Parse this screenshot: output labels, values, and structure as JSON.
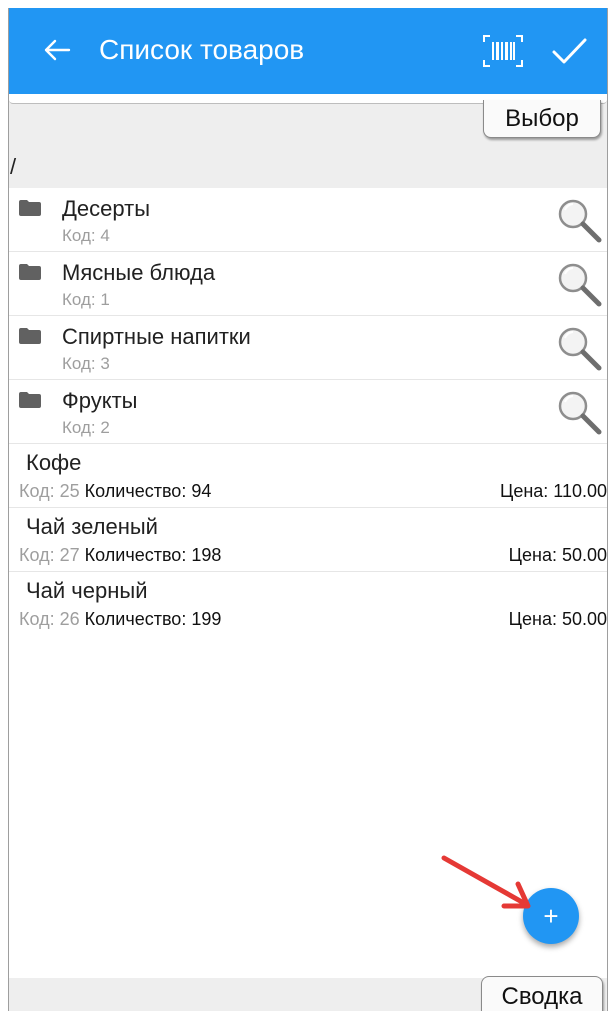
{
  "app_bar": {
    "title": "Список товаров",
    "back_icon": "arrow-left-icon",
    "barcode_icon": "barcode-scan-icon",
    "confirm_icon": "check-icon",
    "color": "#2196f3"
  },
  "tabs": {
    "select_label": "Выбор",
    "summary_label": "Сводка"
  },
  "path": "/",
  "folders": [
    {
      "name": "Десерты",
      "code": "Код: 4"
    },
    {
      "name": "Мясные блюда",
      "code": "Код: 1"
    },
    {
      "name": "Спиртные напитки",
      "code": "Код: 3"
    },
    {
      "name": "Фрукты",
      "code": "Код: 2"
    }
  ],
  "products": [
    {
      "name": "Кофе",
      "code": "Код: 25",
      "quantity": "Количество: 94",
      "price": "Цена: 110.00"
    },
    {
      "name": "Чай зеленый",
      "code": "Код: 27",
      "quantity": "Количество: 198",
      "price": "Цена: 50.00"
    },
    {
      "name": "Чай черный",
      "code": "Код: 26",
      "quantity": "Количество: 199",
      "price": "Цена: 50.00"
    }
  ],
  "fab": {
    "label": "+",
    "color": "#2196f3"
  },
  "annotation_arrow_color": "#e53935"
}
